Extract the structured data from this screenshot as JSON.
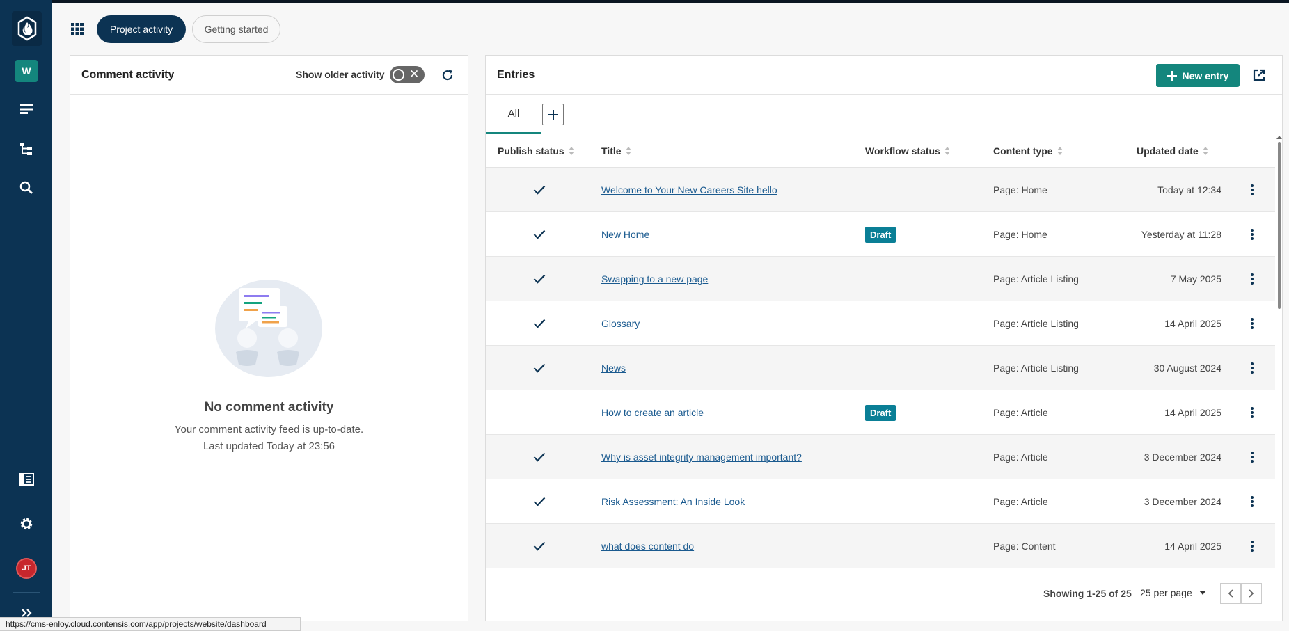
{
  "nav": {
    "workspace_initial": "W",
    "user_initials": "JT",
    "brand_color": "#0c3353",
    "accent_color": "#14867d",
    "icons": [
      "logo-icon",
      "content-icon",
      "site-structure-icon",
      "search-icon",
      "docs-icon",
      "settings-icon",
      "expand-icon"
    ]
  },
  "tabs": {
    "project_activity": "Project activity",
    "getting_started": "Getting started"
  },
  "comments": {
    "title": "Comment activity",
    "show_older_label": "Show older activity",
    "toggle_on": false,
    "empty_title": "No comment activity",
    "empty_line1": "Your comment activity feed is up-to-date.",
    "empty_line2": "Last updated Today at 23:56"
  },
  "entries": {
    "title": "Entries",
    "new_entry_label": "New entry",
    "tab_all": "All",
    "columns": {
      "publish_status": "Publish status",
      "title": "Title",
      "workflow_status": "Workflow status",
      "content_type": "Content type",
      "updated_date": "Updated date"
    },
    "rows": [
      {
        "published": true,
        "title": "Welcome to Your New Careers Site hello",
        "workflow": "",
        "type": "Page: Home",
        "updated": "Today at 12:34"
      },
      {
        "published": true,
        "title": "New Home",
        "workflow": "Draft",
        "type": "Page: Home",
        "updated": "Yesterday at 11:28"
      },
      {
        "published": true,
        "title": "Swapping to a new page",
        "workflow": "",
        "type": "Page: Article Listing",
        "updated": "7 May 2025"
      },
      {
        "published": true,
        "title": "Glossary",
        "workflow": "",
        "type": "Page: Article Listing",
        "updated": "14 April 2025"
      },
      {
        "published": true,
        "title": "News",
        "workflow": "",
        "type": "Page: Article Listing",
        "updated": "30 August 2024"
      },
      {
        "published": false,
        "title": "How to create an article",
        "workflow": "Draft",
        "type": "Page: Article",
        "updated": "14 April 2025"
      },
      {
        "published": true,
        "title": "Why is asset integrity management important?",
        "workflow": "",
        "type": "Page: Article",
        "updated": "3 December 2024"
      },
      {
        "published": true,
        "title": "Risk Assessment: An Inside Look",
        "workflow": "",
        "type": "Page: Article",
        "updated": "3 December 2024"
      },
      {
        "published": true,
        "title": "what does content do",
        "workflow": "",
        "type": "Page: Content",
        "updated": "14 April 2025"
      }
    ],
    "showing": "Showing 1-25 of 25",
    "per_page": "25 per page"
  },
  "status_url": "https://cms-enloy.cloud.contensis.com/app/projects/website/dashboard"
}
